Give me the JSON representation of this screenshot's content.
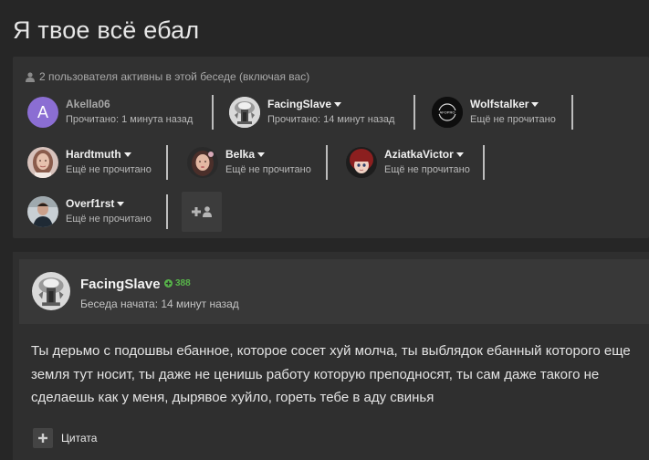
{
  "page": {
    "title": "Я твое всё ебал"
  },
  "participants": {
    "header": "2 пользователя активны в этой беседе (включая вас)",
    "members": [
      {
        "name": "Akella06",
        "status": "Прочитано: 1 минута назад",
        "avatar_letter": "A",
        "has_menu": false
      },
      {
        "name": "FacingSlave",
        "status": "Прочитано: 14 минут назад",
        "has_menu": true
      },
      {
        "name": "Wolfstalker",
        "status": "Ещё не прочитано",
        "has_menu": true
      },
      {
        "name": "Hardtmuth",
        "status": "Ещё не прочитано",
        "has_menu": true
      },
      {
        "name": "Belka",
        "status": "Ещё не прочитано",
        "has_menu": true
      },
      {
        "name": "AziatkaVictor",
        "status": "Ещё не прочитано",
        "has_menu": true
      },
      {
        "name": "Overf1rst",
        "status": "Ещё не прочитано",
        "has_menu": true
      }
    ]
  },
  "message": {
    "author": "FacingSlave",
    "reputation": "388",
    "started": "Беседа начата: 14 минут назад",
    "text": "Ты дерьмо с подошвы ебанное, которое сосет хуй молча, ты выблядок ебанный которого еще земля тут носит, ты даже не ценишь работу которую преподносят, ты сам даже такого не сделаешь как у меня, дырявое хуйло, гореть тебе в аду свинья",
    "quote_label": "Цитата"
  },
  "colors": {
    "background": "#262626",
    "panel": "#313131",
    "reputation_green": "#58b64a",
    "avatar_purple": "#8b6ed3"
  }
}
